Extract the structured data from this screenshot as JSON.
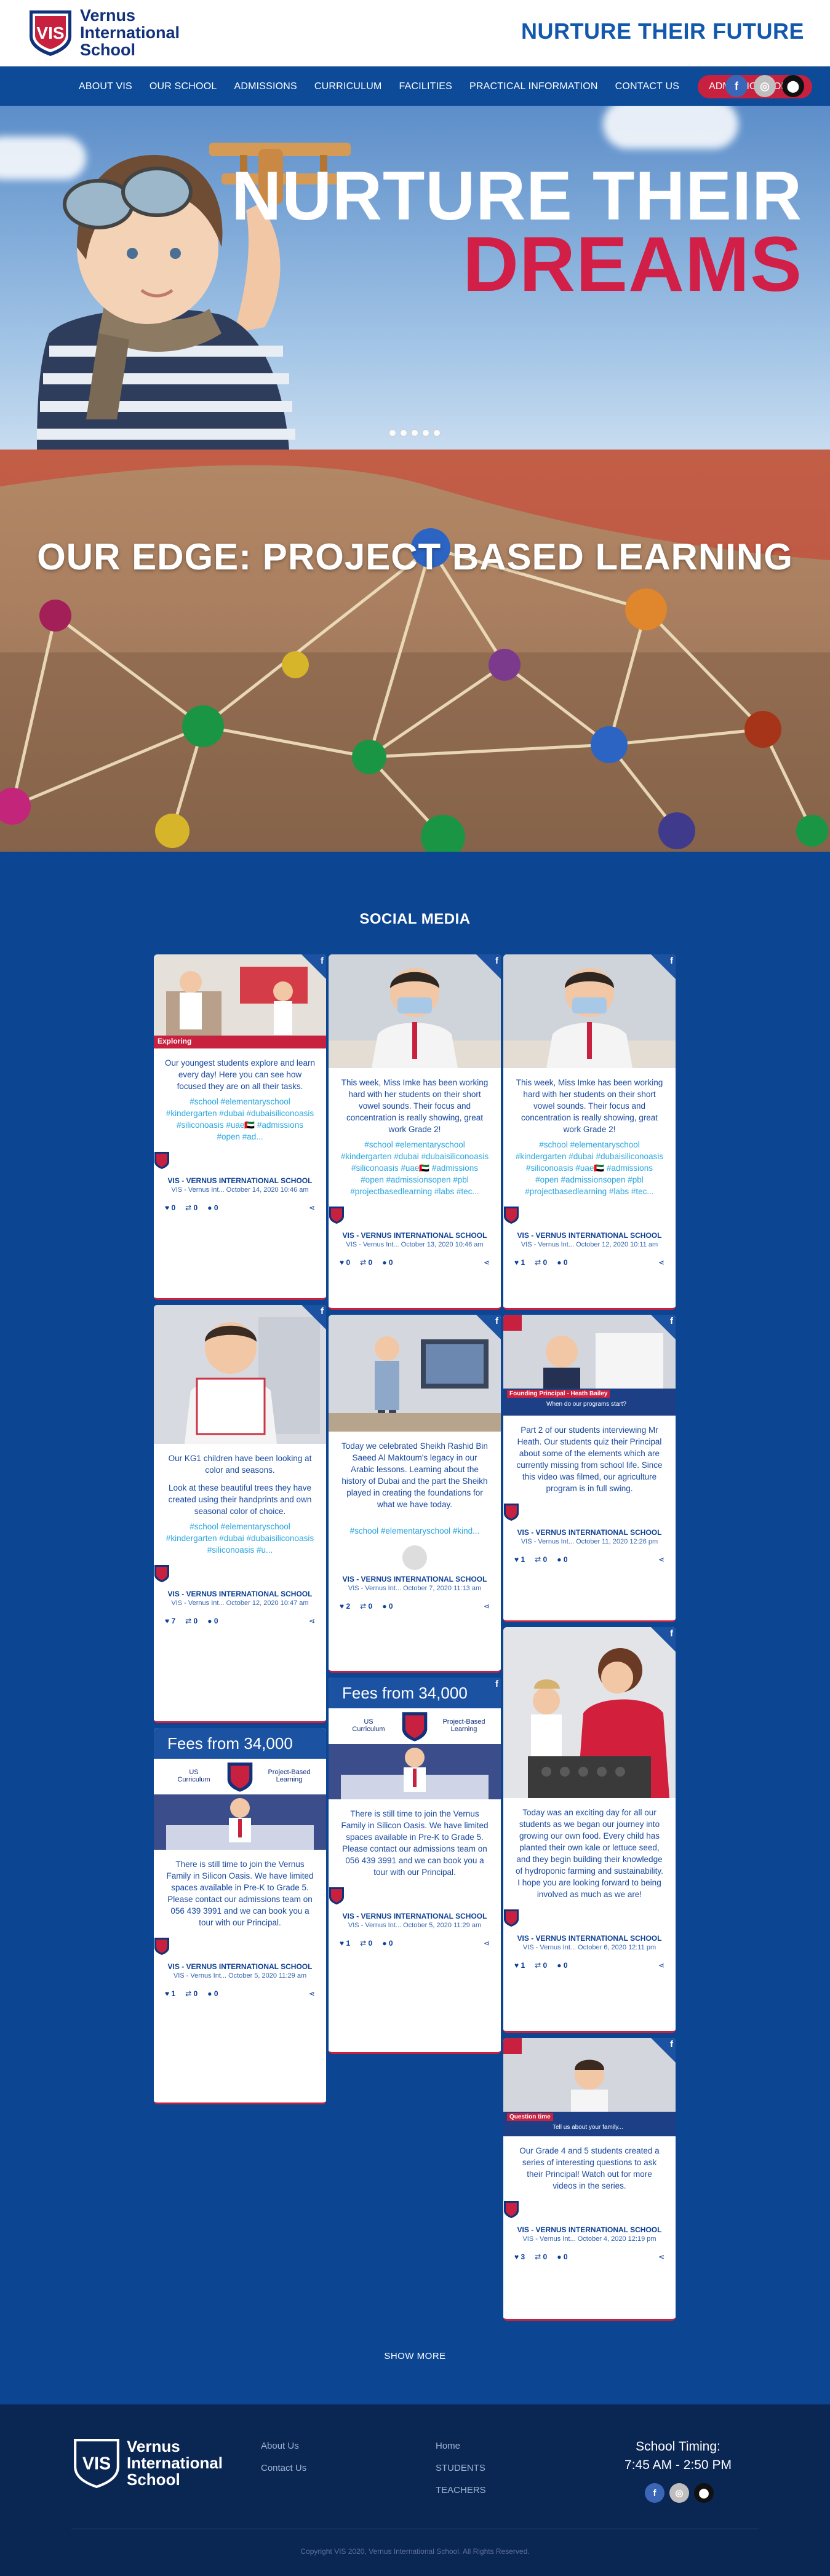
{
  "header": {
    "logo_text_line1": "Vernus",
    "logo_text_line2": "International",
    "logo_text_line3": "School",
    "tagline": "NURTURE THEIR FUTURE"
  },
  "nav": {
    "items": [
      "ABOUT VIS",
      "OUR SCHOOL",
      "ADMISSIONS",
      "CURRICULUM",
      "FACILITIES",
      "PRACTICAL INFORMATION",
      "CONTACT US"
    ],
    "cta": "ADMISSIONS OPEN"
  },
  "hero": {
    "title_line1": "NURTURE THEIR",
    "title_line2": "DREAMS",
    "slide_count": 5
  },
  "edge": {
    "title": "OUR EDGE: PROJECT BASED LEARNING"
  },
  "social": {
    "title": "SOCIAL MEDIA",
    "show_more": "SHOW MORE",
    "cards": [
      {
        "text": "Our youngest students explore and learn every day! Here you can see how focused they are on all their tasks.",
        "tags": "#school #elementaryschool #kindergarten #dubai #dubaisiliconoasis #siliconoasis #uae🇦🇪 #admissions #open #ad...",
        "image_caption": "Exploring",
        "author": "VIS - VERNUS INTERNATIONAL SCHOOL",
        "meta": "VIS - Vernus Int... October 14, 2020 10:46 am",
        "likes": "0",
        "retweets": "0",
        "comments": "0"
      },
      {
        "text": "This week, Miss Imke has been working hard with her students on their short vowel sounds. Their focus and concentration is really showing, great work Grade 2!",
        "tags": "#school #elementaryschool #kindergarten #dubai #dubaisiliconoasis #siliconoasis #uae🇦🇪 #admissions #open #admissionsopen #pbl #projectbasedlearning #labs #tec...",
        "author": "VIS - VERNUS INTERNATIONAL SCHOOL",
        "meta": "VIS - Vernus Int... October 13, 2020 10:46 am",
        "likes": "0",
        "retweets": "0",
        "comments": "0"
      },
      {
        "text": "This week, Miss Imke has been working hard with her students on their short vowel sounds. Their focus and concentration is really showing, great work Grade 2!",
        "tags": "#school #elementaryschool #kindergarten #dubai #dubaisiliconoasis #siliconoasis #uae🇦🇪 #admissions #open #admissionsopen #pbl #projectbasedlearning #labs #tec...",
        "author": "VIS - VERNUS INTERNATIONAL SCHOOL",
        "meta": "VIS - Vernus Int... October 12, 2020 10:11 am",
        "likes": "1",
        "retweets": "0",
        "comments": "0"
      },
      {
        "text": "Our KG1 children have been looking at color and seasons.",
        "text2": "Look at these beautiful trees they have created using their handprints and own seasonal color of choice.",
        "tags": "#school #elementaryschool #kindergarten #dubai #dubaisiliconoasis #siliconoasis #u...",
        "author": "VIS - VERNUS INTERNATIONAL SCHOOL",
        "meta": "VIS - Vernus Int... October 12, 2020 10:47 am",
        "likes": "7",
        "retweets": "0",
        "comments": "0"
      },
      {
        "text": "Today we celebrated Sheikh Rashid Bin Saeed Al Maktoum's legacy in our Arabic lessons. Learning about the history of Dubai and the part the Sheikh played in creating the foundations for what we have today.",
        "tags": "#school #elementaryschool #kind...",
        "author": "VIS - VERNUS INTERNATIONAL SCHOOL",
        "meta": "VIS - Vernus Int... October 7, 2020 11:13 am",
        "likes": "2",
        "retweets": "0",
        "comments": "0"
      },
      {
        "text": "Part 2 of our students interviewing Mr Heath. Our students quiz their Principal about some of the elements which are currently missing from school life. Since this video was filmed, our agriculture program is in full swing.",
        "image_caption": "Founding Principal - Heath Bailey",
        "image_caption2": "When do our programs start?",
        "author": "VIS - VERNUS INTERNATIONAL SCHOOL",
        "meta": "VIS - Vernus Int... October 11, 2020 12:26 pm",
        "likes": "1",
        "retweets": "0",
        "comments": "0"
      },
      {
        "banner": "Fees from 34,000 AED",
        "sub_left": "US Curriculum",
        "sub_right": "Project-Based Learning",
        "text": "There is still time to join the Vernus Family in Silicon Oasis. We have limited spaces available in Pre-K to Grade 5. Please contact our admissions team on 056 439 3991 and we can book you a tour with our Principal.",
        "author": "VIS - VERNUS INTERNATIONAL SCHOOL",
        "meta": "VIS - Vernus Int... October 5, 2020 11:29 am",
        "likes": "1",
        "retweets": "0",
        "comments": "0"
      },
      {
        "banner": "Fees from 34,000 AED",
        "sub_left": "US Curriculum",
        "sub_right": "Project-Based Learning",
        "text": "There is still time to join the Vernus Family in Silicon Oasis. We have limited spaces available in Pre-K to Grade 5. Please contact our admissions team on 056 439 3991 and we can book you a tour with our Principal.",
        "author": "VIS - VERNUS INTERNATIONAL SCHOOL",
        "meta": "VIS - Vernus Int... October 5, 2020 11:29 am",
        "likes": "1",
        "retweets": "0",
        "comments": "0"
      },
      {
        "text": "Today was an exciting day for all our students as we began our journey into growing our own food. Every child has planted their own kale or lettuce seed, and they begin building their knowledge of hydroponic farming and sustainability. I hope you are looking forward to being involved as much as we are!",
        "author": "VIS - VERNUS INTERNATIONAL SCHOOL",
        "meta": "VIS - Vernus Int... October 6, 2020 12:11 pm",
        "likes": "1",
        "retweets": "0",
        "comments": "0"
      },
      {
        "text": "Our Grade 4 and 5 students created a series of interesting questions to ask their Principal! Watch out for more videos in the series.",
        "image_caption": "Question time",
        "image_caption2": "Tell us about your family...",
        "author": "VIS - VERNUS INTERNATIONAL SCHOOL",
        "meta": "VIS - Vernus Int... October 4, 2020 12:19 pm",
        "likes": "3",
        "retweets": "0",
        "comments": "0"
      }
    ]
  },
  "footer": {
    "logo_line1": "Vernus",
    "logo_line2": "International",
    "logo_line3": "School",
    "col1": [
      "About Us",
      "Contact Us"
    ],
    "col2": [
      "Home",
      "STUDENTS",
      "TEACHERS"
    ],
    "timing_label": "School Timing:",
    "timing_hours": "7:45 AM - 2:50 PM",
    "copyright": "Copyright VIS 2020, Vernus International School. All Rights Reserved."
  },
  "colors": {
    "brand_blue": "#0d4a97",
    "brand_red": "#c8203f",
    "social_bg": "#0c4693",
    "footer_bg": "#0a2653"
  }
}
